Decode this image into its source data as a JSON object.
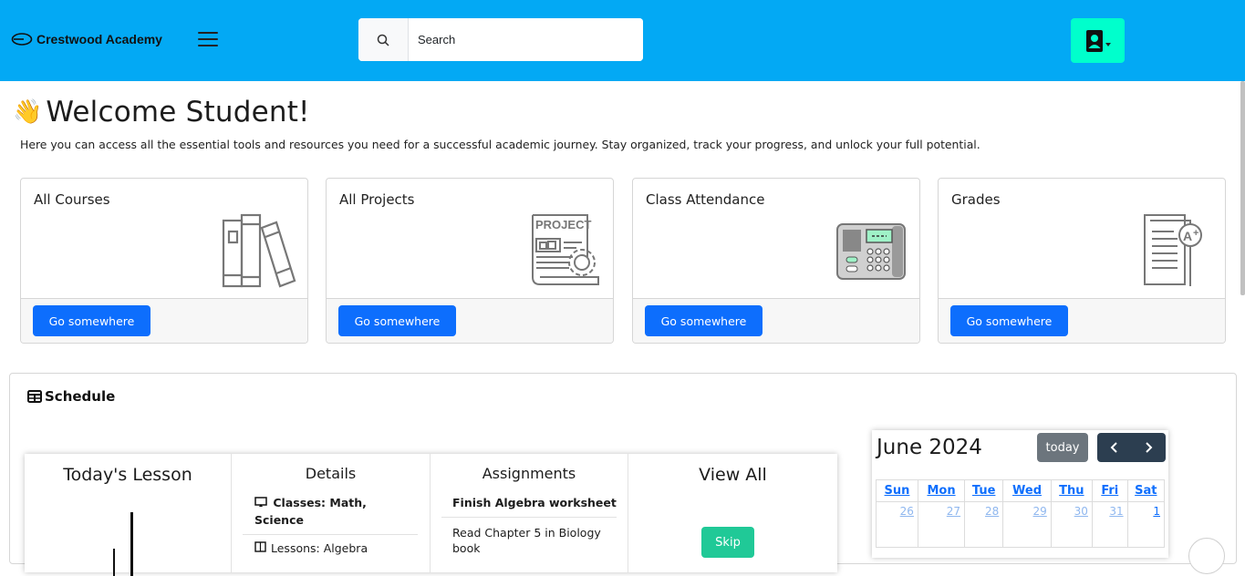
{
  "header": {
    "brand": "Crestwood Academy",
    "search_placeholder": "Search"
  },
  "welcome": {
    "emoji": "👋",
    "title": "Welcome Student!",
    "intro": "Here you can access all the essential tools and resources you need for a successful academic journey. Stay organized, track your progress, and unlock your full potential."
  },
  "cards": [
    {
      "title": "All Courses",
      "icon": "books-icon",
      "button": "Go somewhere"
    },
    {
      "title": "All Projects",
      "icon": "project-icon",
      "button": "Go somewhere"
    },
    {
      "title": "Class Attendance",
      "icon": "attendance-machine-icon",
      "button": "Go somewhere"
    },
    {
      "title": "Grades",
      "icon": "grade-report-icon",
      "button": "Go somewhere"
    }
  ],
  "schedule": {
    "title": "Schedule",
    "today_heading": "Today's Lesson",
    "details_heading": "Details",
    "classes": "Classes: Math, Science",
    "lessons": "Lessons: Algebra",
    "assignments_heading": "Assignments",
    "assignment_1": "Finish Algebra worksheet",
    "assignment_2": "Read Chapter 5 in Biology book",
    "view_all_heading": "View All",
    "skip_label": "Skip"
  },
  "calendar": {
    "title": "June 2024",
    "today_label": "today",
    "weekdays": [
      "Sun",
      "Mon",
      "Tue",
      "Wed",
      "Thu",
      "Fri",
      "Sat"
    ],
    "first_week": [
      "26",
      "27",
      "28",
      "29",
      "30",
      "31",
      "1"
    ]
  },
  "colors": {
    "header_bg": "#03a9f4",
    "profile_bg": "#00ffcc",
    "primary": "#0d6efd",
    "skip": "#20c997"
  }
}
